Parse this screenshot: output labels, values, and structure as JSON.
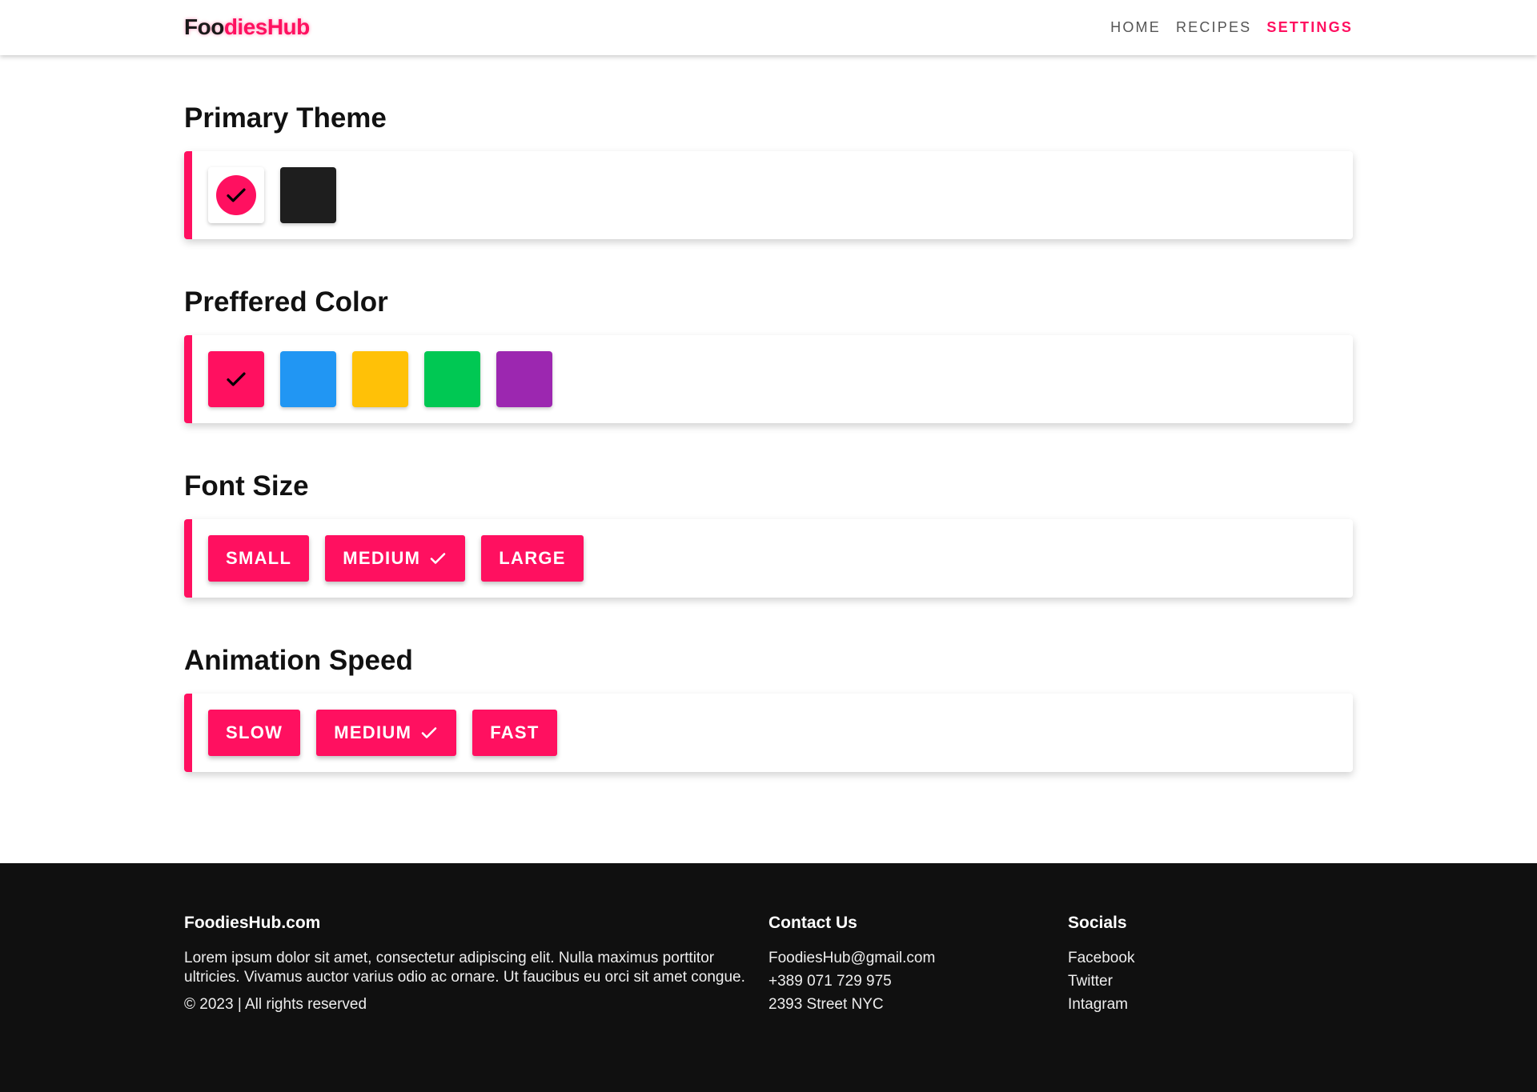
{
  "nav": {
    "logo_part1": "Foo",
    "logo_part2": "diesHub",
    "links": [
      "HOME",
      "RECIPES",
      "SETTINGS"
    ],
    "active_link": "SETTINGS"
  },
  "sections": {
    "primary_theme": {
      "title": "Primary Theme",
      "options": [
        {
          "name": "light",
          "color": "#ffffff",
          "accent": "#ff1060",
          "selected": true
        },
        {
          "name": "dark",
          "color": "#1e1e1e",
          "selected": false
        }
      ]
    },
    "preferred_color": {
      "title": "Preffered Color",
      "options": [
        {
          "name": "pink",
          "color": "#ff1060",
          "selected": true
        },
        {
          "name": "blue",
          "color": "#2196f3",
          "selected": false
        },
        {
          "name": "yellow",
          "color": "#ffc107",
          "selected": false
        },
        {
          "name": "green",
          "color": "#00c853",
          "selected": false
        },
        {
          "name": "purple",
          "color": "#9c27b0",
          "selected": false
        }
      ]
    },
    "font_size": {
      "title": "Font Size",
      "options": [
        "SMALL",
        "MEDIUM",
        "LARGE"
      ],
      "selected": "MEDIUM"
    },
    "animation_speed": {
      "title": "Animation Speed",
      "options": [
        "SLOW",
        "MEDIUM",
        "FAST"
      ],
      "selected": "MEDIUM"
    }
  },
  "footer": {
    "about": {
      "title": "FoodiesHub.com",
      "text": "Lorem ipsum dolor sit amet, consectetur adipiscing elit. Nulla maximus porttitor ultricies. Vivamus auctor varius odio ac ornare. Ut faucibus eu orci sit amet congue.",
      "copyright": "© 2023 | All rights reserved"
    },
    "contact": {
      "title": "Contact Us",
      "email": "FoodiesHub@gmail.com",
      "phone": "+389 071 729 975",
      "address": "2393 Street NYC"
    },
    "socials": {
      "title": "Socials",
      "links": [
        "Facebook",
        "Twitter",
        "Intagram"
      ]
    }
  },
  "colors": {
    "accent": "#ff1060",
    "footer_bg": "#101010"
  },
  "icons": {
    "check": "check-icon"
  }
}
